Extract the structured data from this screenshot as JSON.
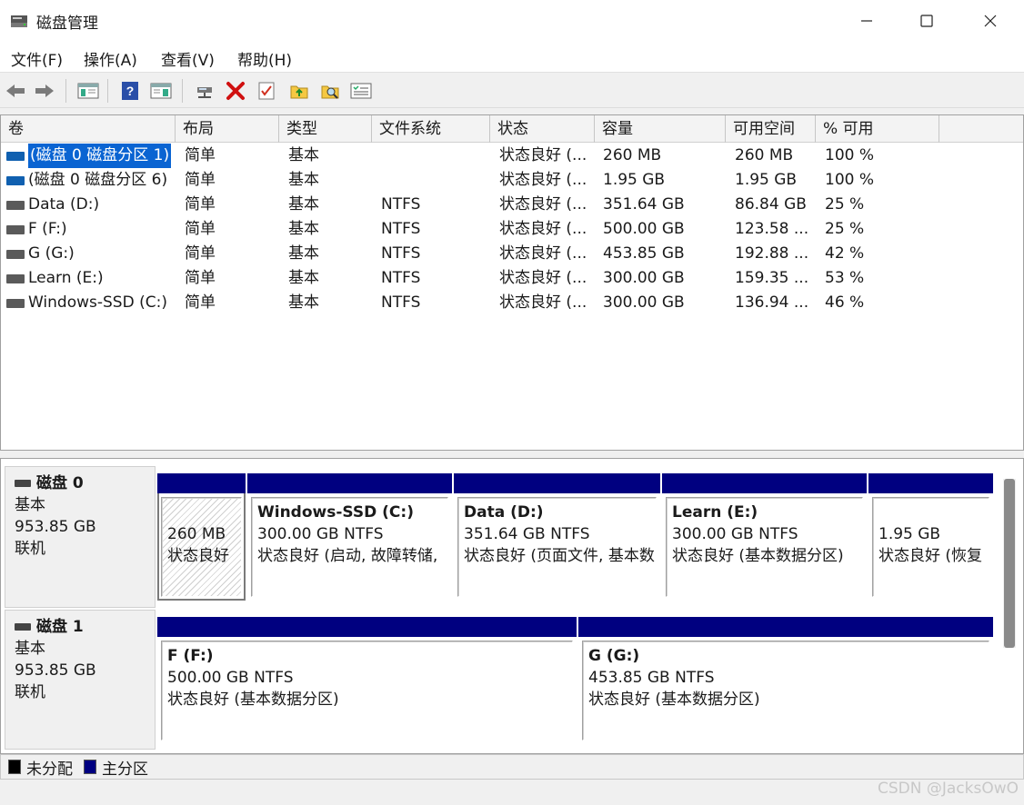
{
  "window": {
    "title": "磁盘管理"
  },
  "menu": [
    "文件(F)",
    "操作(A)",
    "查看(V)",
    "帮助(H)"
  ],
  "columns": [
    "卷",
    "布局",
    "类型",
    "文件系统",
    "状态",
    "容量",
    "可用空间",
    "% 可用"
  ],
  "volumes": [
    {
      "name": "(磁盘 0 磁盘分区 1)",
      "layout": "简单",
      "type": "基本",
      "fs": "",
      "status": "状态良好 (...",
      "capacity": "260 MB",
      "free": "260 MB",
      "pct": "100 %"
    },
    {
      "name": "(磁盘 0 磁盘分区 6)",
      "layout": "简单",
      "type": "基本",
      "fs": "",
      "status": "状态良好 (...",
      "capacity": "1.95 GB",
      "free": "1.95 GB",
      "pct": "100 %"
    },
    {
      "name": "Data (D:)",
      "layout": "简单",
      "type": "基本",
      "fs": "NTFS",
      "status": "状态良好 (...",
      "capacity": "351.64 GB",
      "free": "86.84 GB",
      "pct": "25 %"
    },
    {
      "name": "F (F:)",
      "layout": "简单",
      "type": "基本",
      "fs": "NTFS",
      "status": "状态良好 (...",
      "capacity": "500.00 GB",
      "free": "123.58 ...",
      "pct": "25 %"
    },
    {
      "name": "G (G:)",
      "layout": "简单",
      "type": "基本",
      "fs": "NTFS",
      "status": "状态良好 (...",
      "capacity": "453.85 GB",
      "free": "192.88 ...",
      "pct": "42 %"
    },
    {
      "name": "Learn (E:)",
      "layout": "简单",
      "type": "基本",
      "fs": "NTFS",
      "status": "状态良好 (...",
      "capacity": "300.00 GB",
      "free": "159.35 ...",
      "pct": "53 %"
    },
    {
      "name": "Windows-SSD (C:)",
      "layout": "简单",
      "type": "基本",
      "fs": "NTFS",
      "status": "状态良好 (...",
      "capacity": "300.00 GB",
      "free": "136.94 ...",
      "pct": "46 %"
    }
  ],
  "disks": [
    {
      "name": "磁盘 0",
      "kind": "基本",
      "size": "953.85 GB",
      "state": "联机",
      "partitions": [
        {
          "name": "",
          "size": "260 MB",
          "status": "状态良好"
        },
        {
          "name": "Windows-SSD  (C:)",
          "size": "300.00 GB NTFS",
          "status": "状态良好 (启动, 故障转储,"
        },
        {
          "name": "Data  (D:)",
          "size": "351.64 GB NTFS",
          "status": "状态良好 (页面文件, 基本数"
        },
        {
          "name": "Learn  (E:)",
          "size": "300.00 GB NTFS",
          "status": "状态良好 (基本数据分区)"
        },
        {
          "name": "",
          "size": "1.95 GB",
          "status": "状态良好 (恢复"
        }
      ]
    },
    {
      "name": "磁盘 1",
      "kind": "基本",
      "size": "953.85 GB",
      "state": "联机",
      "partitions": [
        {
          "name": "F  (F:)",
          "size": "500.00 GB NTFS",
          "status": "状态良好 (基本数据分区)"
        },
        {
          "name": "G  (G:)",
          "size": "453.85 GB NTFS",
          "status": "状态良好 (基本数据分区)"
        }
      ]
    }
  ],
  "legend": {
    "unallocated": "未分配",
    "primary": "主分区",
    "unallocated_color": "#000000",
    "primary_color": "#000080"
  },
  "watermark": "CSDN @JacksOwO"
}
